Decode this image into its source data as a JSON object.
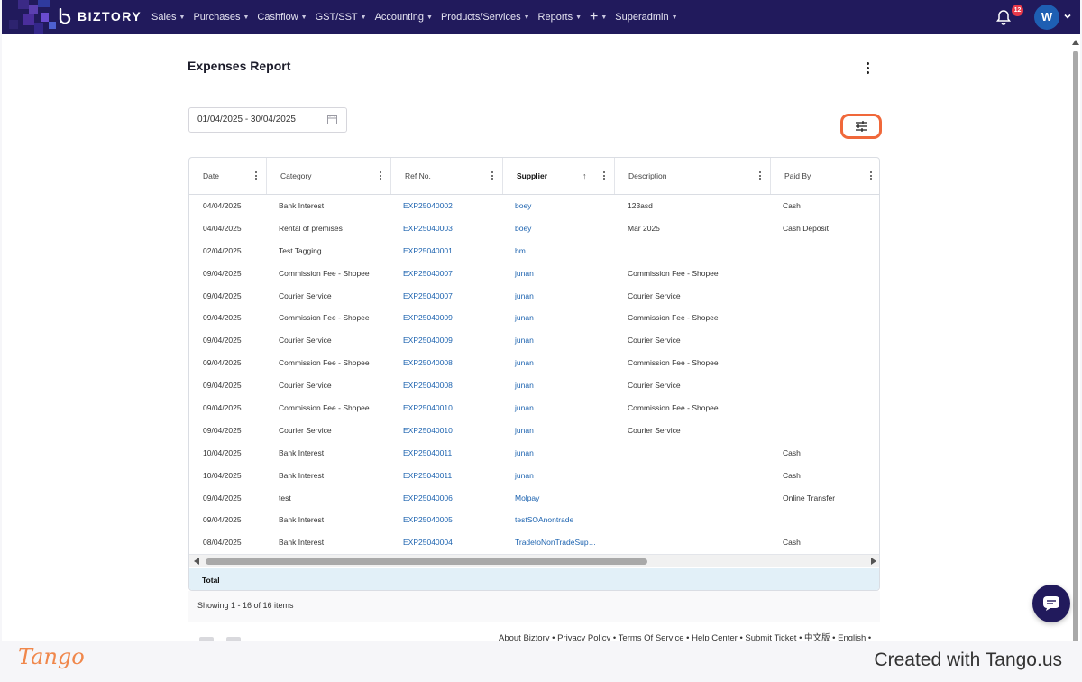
{
  "app": {
    "brand": "BIZTORY",
    "notification_count": "12",
    "avatar_initial": "W"
  },
  "nav": {
    "items": [
      {
        "label": "Sales"
      },
      {
        "label": "Purchases"
      },
      {
        "label": "Cashflow"
      },
      {
        "label": "GST/SST"
      },
      {
        "label": "Accounting"
      },
      {
        "label": "Products/Services"
      },
      {
        "label": "Reports"
      },
      {
        "label": "+"
      },
      {
        "label": "Superadmin"
      }
    ]
  },
  "report": {
    "title": "Expenses Report",
    "date_range": "01/04/2025 - 30/04/2025",
    "columns": [
      "Date",
      "Category",
      "Ref No.",
      "Supplier",
      "Description",
      "Paid By"
    ],
    "sorted_column": "Supplier",
    "sort_direction": "ascending",
    "rows": [
      {
        "date": "04/04/2025",
        "category": "Bank Interest",
        "ref": "EXP25040002",
        "supplier": "boey",
        "description": "123asd",
        "paid_by": "Cash"
      },
      {
        "date": "04/04/2025",
        "category": "Rental of premises",
        "ref": "EXP25040003",
        "supplier": "boey",
        "description": "Mar 2025",
        "paid_by": "Cash Deposit"
      },
      {
        "date": "02/04/2025",
        "category": "Test Tagging",
        "ref": "EXP25040001",
        "supplier": "bm",
        "description": "",
        "paid_by": ""
      },
      {
        "date": "09/04/2025",
        "category": "Commission Fee - Shopee",
        "ref": "EXP25040007",
        "supplier": "junan",
        "description": "Commission Fee - Shopee",
        "paid_by": ""
      },
      {
        "date": "09/04/2025",
        "category": "Courier Service",
        "ref": "EXP25040007",
        "supplier": "junan",
        "description": "Courier Service",
        "paid_by": ""
      },
      {
        "date": "09/04/2025",
        "category": "Commission Fee - Shopee",
        "ref": "EXP25040009",
        "supplier": "junan",
        "description": "Commission Fee - Shopee",
        "paid_by": ""
      },
      {
        "date": "09/04/2025",
        "category": "Courier Service",
        "ref": "EXP25040009",
        "supplier": "junan",
        "description": "Courier Service",
        "paid_by": ""
      },
      {
        "date": "09/04/2025",
        "category": "Commission Fee - Shopee",
        "ref": "EXP25040008",
        "supplier": "junan",
        "description": "Commission Fee - Shopee",
        "paid_by": ""
      },
      {
        "date": "09/04/2025",
        "category": "Courier Service",
        "ref": "EXP25040008",
        "supplier": "junan",
        "description": "Courier Service",
        "paid_by": ""
      },
      {
        "date": "09/04/2025",
        "category": "Commission Fee - Shopee",
        "ref": "EXP25040010",
        "supplier": "junan",
        "description": "Commission Fee - Shopee",
        "paid_by": ""
      },
      {
        "date": "09/04/2025",
        "category": "Courier Service",
        "ref": "EXP25040010",
        "supplier": "junan",
        "description": "Courier Service",
        "paid_by": ""
      },
      {
        "date": "10/04/2025",
        "category": "Bank Interest",
        "ref": "EXP25040011",
        "supplier": "junan",
        "description": "",
        "paid_by": "Cash"
      },
      {
        "date": "10/04/2025",
        "category": "Bank Interest",
        "ref": "EXP25040011",
        "supplier": "junan",
        "description": "",
        "paid_by": "Cash"
      },
      {
        "date": "09/04/2025",
        "category": "test",
        "ref": "EXP25040006",
        "supplier": "Molpay",
        "description": "",
        "paid_by": "Online Transfer"
      },
      {
        "date": "09/04/2025",
        "category": "Bank Interest",
        "ref": "EXP25040005",
        "supplier": "testSOAnontrade",
        "description": "",
        "paid_by": ""
      },
      {
        "date": "08/04/2025",
        "category": "Bank Interest",
        "ref": "EXP25040004",
        "supplier": "TradetoNonTradeSup…",
        "description": "",
        "paid_by": "Cash"
      }
    ],
    "total_label": "Total",
    "showing_text": "Showing 1 - 16 of 16 items"
  },
  "footer": {
    "links_text": "About Biztory • Privacy Policy • Terms Of Service • Help Center • Submit Ticket • 中文版 • English •"
  },
  "tango": {
    "logo": "Tango",
    "credit": "Created with Tango.us"
  },
  "colors": {
    "topbar": "#211a5c",
    "link": "#1e64b0",
    "highlight": "#f0683a",
    "total_row": "#e2f0f8"
  }
}
